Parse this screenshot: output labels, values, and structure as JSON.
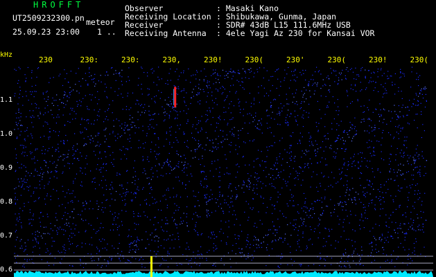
{
  "app": {
    "title": "HROFFT",
    "filename": "UT2509232300.pn",
    "mode": "meteor",
    "date": "25.09.23 23:00",
    "frame": "1 .."
  },
  "info": {
    "rows": [
      {
        "label": "Observer",
        "value": ": Masaki Kano"
      },
      {
        "label": "Receiving Location",
        "value": ": Shibukawa, Gunma, Japan"
      },
      {
        "label": "Receiver",
        "value": ": SDR# 43dB L15 111.6MHz USB"
      },
      {
        "label": "Receiving Antenna",
        "value": ": 4ele Yagi Az 230 for Kansai VOR"
      }
    ]
  },
  "colors": {
    "title": "#00ff40",
    "text": "#ffffff",
    "axis_text": "#ffff00",
    "noise": "#1a2bff",
    "baseline": "#00e8ff",
    "carrier": "#ffff00",
    "hline": "#e0e0ff"
  },
  "chart_data": {
    "type": "heatmap",
    "ylabel": "kHz",
    "y_ticks": [
      "1.1",
      "1.0",
      "0.9",
      "0.8",
      "0.7",
      "0.6"
    ],
    "x_ticks": [
      "230",
      "230:",
      "230:",
      "230,",
      "230!",
      "230(",
      "230'",
      "230(",
      "230!",
      "230(",
      "2310"
    ],
    "ylim": [
      0.58,
      1.2
    ],
    "events": [
      {
        "name": "meteor echo",
        "time_index": 3.6,
        "freq_khz": [
          1.08,
          1.14
        ]
      }
    ]
  }
}
